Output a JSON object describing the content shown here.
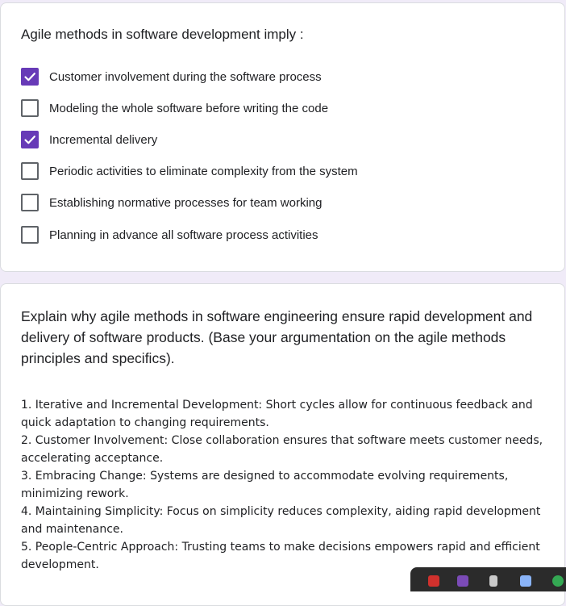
{
  "question1": {
    "title": "Agile methods in software development imply :",
    "options": [
      {
        "label": "Customer involvement during the software process",
        "checked": true
      },
      {
        "label": "Modeling the whole software before writing the code",
        "checked": false
      },
      {
        "label": "Incremental delivery",
        "checked": true
      },
      {
        "label": "Periodic activities to eliminate complexity from the system",
        "checked": false
      },
      {
        "label": "Establishing normative processes for team working",
        "checked": false
      },
      {
        "label": "Planning in advance all software process activities",
        "checked": false
      }
    ]
  },
  "question2": {
    "title": "Explain why agile methods in software engineering ensure rapid development and delivery of software products. (Base your argumentation on the agile methods principles and specifics).",
    "answer_lines": [
      "1. Iterative and Incremental Development: Short cycles allow for continuous feedback and quick adaptation to changing requirements.",
      "2. Customer Involvement: Close collaboration ensures that software meets customer needs, accelerating acceptance.",
      "3. Embracing Change: Systems are designed to accommodate evolving requirements, minimizing rework.",
      "4. Maintaining Simplicity: Focus on simplicity reduces complexity, aiding rapid development and maintenance.",
      "5. People-Centric Approach: Trusting teams to make decisions empowers rapid and efficient development."
    ]
  },
  "colors": {
    "accent": "#673ab7",
    "background": "#f0ebf8",
    "card": "#ffffff"
  }
}
